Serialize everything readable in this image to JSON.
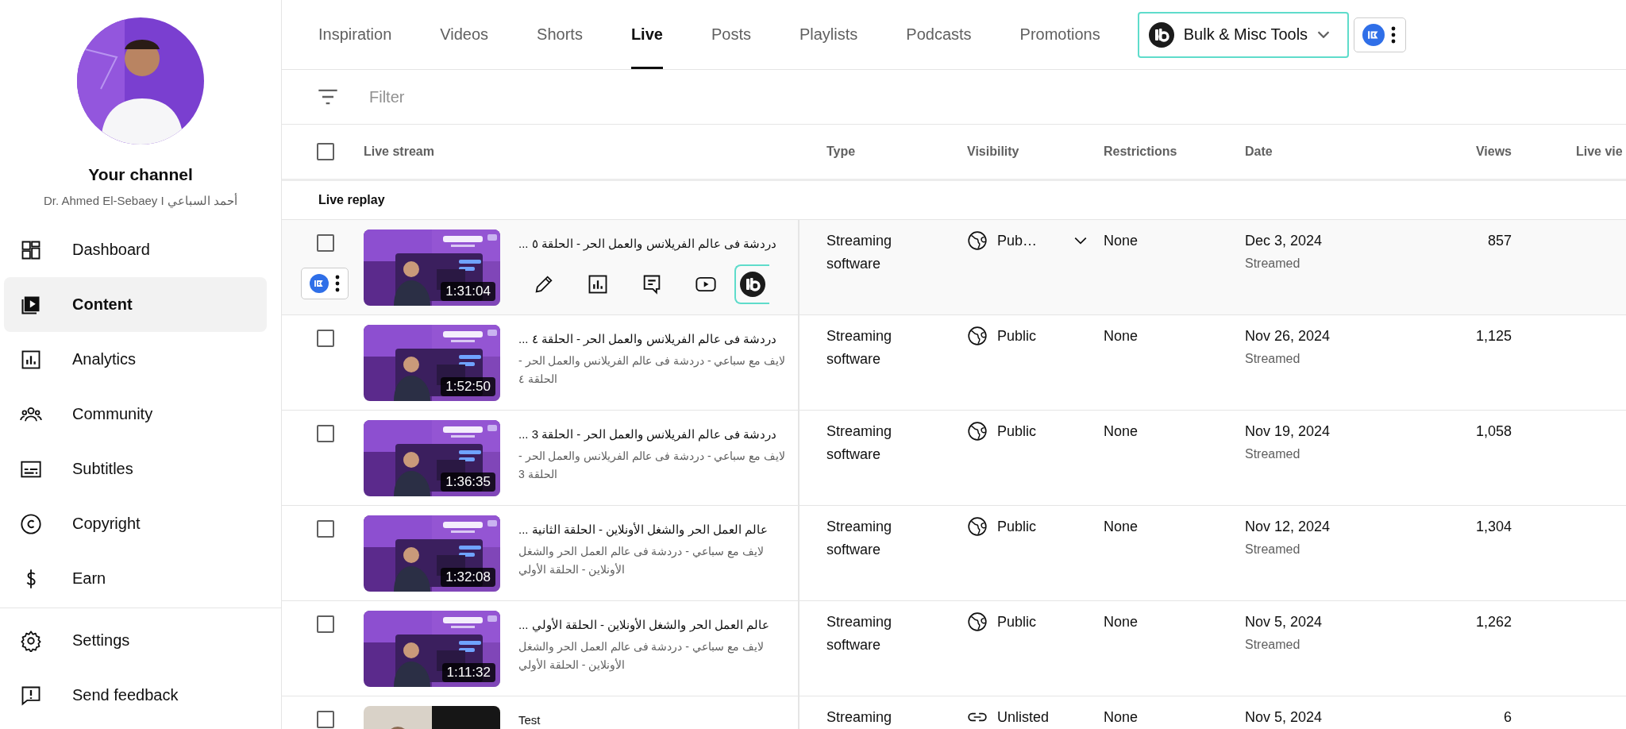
{
  "sidebar": {
    "channel_title": "Your channel",
    "channel_name": "Dr. Ahmed El-Sebaey I أحمد السباعي",
    "items": [
      {
        "label": "Dashboard",
        "kind": "dashboard",
        "selected": false
      },
      {
        "label": "Content",
        "kind": "content",
        "selected": true
      },
      {
        "label": "Analytics",
        "kind": "analytics",
        "selected": false
      },
      {
        "label": "Community",
        "kind": "community",
        "selected": false
      },
      {
        "label": "Subtitles",
        "kind": "subtitles",
        "selected": false
      },
      {
        "label": "Copyright",
        "kind": "copyright",
        "selected": false
      },
      {
        "label": "Earn",
        "kind": "earn",
        "selected": false
      }
    ],
    "footer_items": [
      {
        "label": "Settings",
        "kind": "settings",
        "selected": false
      },
      {
        "label": "Send feedback",
        "kind": "feedback",
        "selected": false
      }
    ]
  },
  "tabs": [
    {
      "label": "Inspiration",
      "selected": false
    },
    {
      "label": "Videos",
      "selected": false
    },
    {
      "label": "Shorts",
      "selected": false
    },
    {
      "label": "Live",
      "selected": true
    },
    {
      "label": "Posts",
      "selected": false
    },
    {
      "label": "Playlists",
      "selected": false
    },
    {
      "label": "Podcasts",
      "selected": false
    },
    {
      "label": "Promotions",
      "selected": false
    }
  ],
  "tools_button": {
    "label": "Bulk & Misc Tools"
  },
  "filter": {
    "placeholder": "Filter"
  },
  "table": {
    "select_all": {
      "checked": false
    },
    "columns": [
      "Live stream",
      "Type",
      "Visibility",
      "Restrictions",
      "Date",
      "Views",
      "Live vie"
    ],
    "section": "Live replay",
    "rows": [
      {
        "checked": false,
        "hovered": true,
        "title": "دردشة فى عالم الفريلانس والعمل الحر - الحلقة ٥ ...",
        "duration": "1:31:04",
        "type": [
          "Streaming",
          "software"
        ],
        "visibility": {
          "kind": "public",
          "label": "Pub…"
        },
        "restrictions": "None",
        "date": "Dec 3, 2024",
        "date_note": "Streamed",
        "views": "857"
      },
      {
        "checked": false,
        "hovered": false,
        "title": "دردشة فى عالم الفريلانس والعمل الحر - الحلقة ٤ ...",
        "description": "لايف مع سباعي - دردشة فى عالم الفريلانس والعمل الحر - الحلقة ٤",
        "duration": "1:52:50",
        "type": [
          "Streaming",
          "software"
        ],
        "visibility": {
          "kind": "public",
          "label": "Public"
        },
        "restrictions": "None",
        "date": "Nov 26, 2024",
        "date_note": "Streamed",
        "views": "1,125"
      },
      {
        "checked": false,
        "hovered": false,
        "title": "دردشة فى عالم الفريلانس والعمل الحر - الحلقة 3 ...",
        "description": "لايف مع سباعي - دردشة فى عالم الفريلانس والعمل الحر - الحلقة 3",
        "duration": "1:36:35",
        "type": [
          "Streaming",
          "software"
        ],
        "visibility": {
          "kind": "public",
          "label": "Public"
        },
        "restrictions": "None",
        "date": "Nov 19, 2024",
        "date_note": "Streamed",
        "views": "1,058"
      },
      {
        "checked": false,
        "hovered": false,
        "title": "عالم العمل الحر والشغل الأونلاين - الحلقة الثانية ...",
        "description": "لايف مع سباعي - دردشة فى عالم العمل الحر والشغل الأونلاين - الحلقة الأولي",
        "duration": "1:32:08",
        "type": [
          "Streaming",
          "software"
        ],
        "visibility": {
          "kind": "public",
          "label": "Public"
        },
        "restrictions": "None",
        "date": "Nov 12, 2024",
        "date_note": "Streamed",
        "views": "1,304"
      },
      {
        "checked": false,
        "hovered": false,
        "title": "عالم العمل الحر والشغل الأونلاين - الحلقة الأولي ...",
        "description": "لايف مع سباعي - دردشة فى عالم العمل الحر والشغل الأونلاين - الحلقة الأولي",
        "duration": "1:11:32",
        "type": [
          "Streaming",
          "software"
        ],
        "visibility": {
          "kind": "public",
          "label": "Public"
        },
        "restrictions": "None",
        "date": "Nov 5, 2024",
        "date_note": "Streamed",
        "views": "1,262"
      },
      {
        "checked": false,
        "hovered": false,
        "title": "Test",
        "type": [
          "Streaming"
        ],
        "visibility": {
          "kind": "unlisted",
          "label": "Unlisted"
        },
        "restrictions": "None",
        "date": "Nov 5, 2024",
        "views": "6"
      }
    ]
  }
}
